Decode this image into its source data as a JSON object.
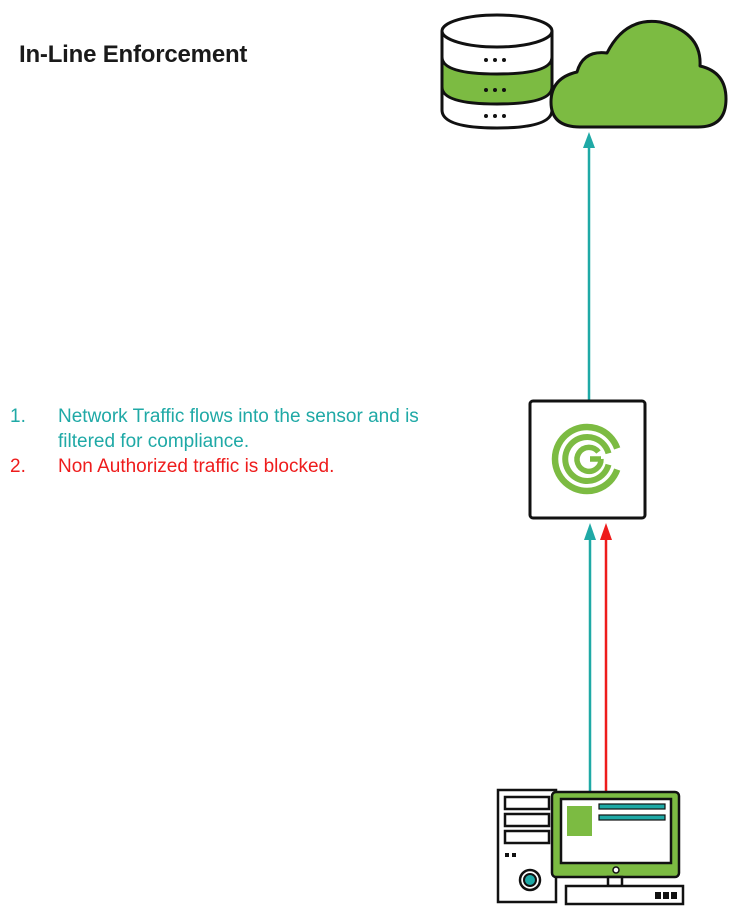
{
  "title": "In-Line Enforcement",
  "steps": [
    {
      "number": "1.",
      "text": "Network Traffic flows into the sensor and is filtered for compliance.",
      "line1": "Network Traffic flows into the sensor and is",
      "line2": "filtered for compliance."
    },
    {
      "number": "2.",
      "text": "Non Authorized traffic is blocked."
    }
  ],
  "colors": {
    "allowed": "#1fa9a6",
    "blocked": "#ee1c1c",
    "accent_green": "#7cbb42",
    "outline": "#111111"
  },
  "icons": {
    "database": "database-icon",
    "cloud": "cloud-icon",
    "sensor": "sensor-logo-icon",
    "workstation": "computer-icon"
  }
}
